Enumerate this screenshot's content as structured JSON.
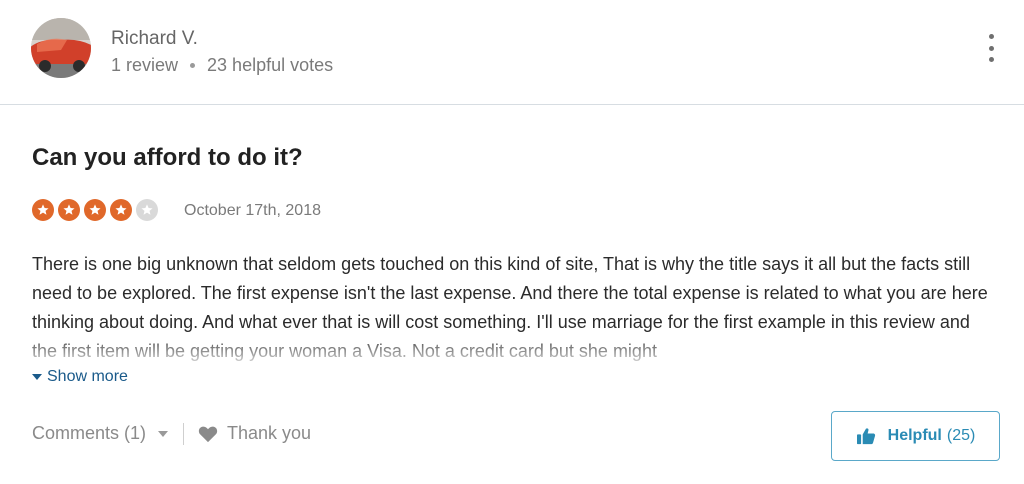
{
  "reviewer": {
    "name": "Richard V.",
    "review_count": "1 review",
    "helpful_votes": "23 helpful votes"
  },
  "menu": {
    "icon": "more-vertical-icon"
  },
  "review": {
    "title": "Can you afford to do it?",
    "rating": 4,
    "rating_max": 5,
    "date": "October 17th, 2018",
    "text": "There is one big unknown that seldom gets touched on this kind of site, That is why the title says it all but the facts still need to be explored. The first expense isn't the last expense. And there the total expense is related to what you are here thinking about doing. And what ever that is will cost something. I'll use marriage for the first example in this review and the first item will be getting your woman a Visa. Not a credit card but she might",
    "show_more_label": "Show more"
  },
  "actions": {
    "comments_label": "Comments (1)",
    "thank_you_label": "Thank you",
    "helpful_label": "Helpful",
    "helpful_count": "(25)"
  },
  "colors": {
    "star_filled": "#e0682a",
    "star_empty": "#d9d9d9",
    "link": "#1a5a8a",
    "helpful_accent": "#2a8bb4"
  }
}
